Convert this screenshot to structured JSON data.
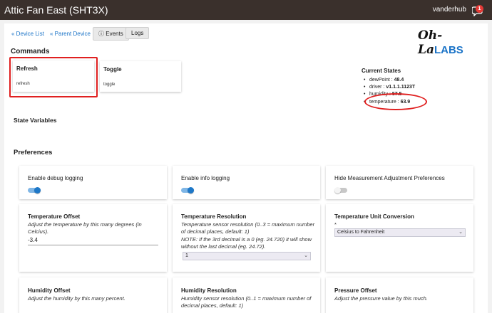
{
  "header": {
    "title": "Attic Fan East (SHT3X)",
    "user": "vanderhub",
    "notification_count": "1"
  },
  "nav": {
    "device_list": "« Device List",
    "parent_device": "« Parent Device",
    "events": "Events",
    "logs": "Logs"
  },
  "logo": {
    "script": "Oh-La",
    "labs": "LABS"
  },
  "commands": {
    "title": "Commands",
    "items": [
      {
        "name": "Refresh",
        "sub": "refresh"
      },
      {
        "name": "Toggle",
        "sub": "toggle"
      }
    ]
  },
  "current_states": {
    "title": "Current States",
    "items": [
      {
        "key": "dewPoint : ",
        "value": "48.4"
      },
      {
        "key": "driver : ",
        "value": "v1.1.1.1123T"
      },
      {
        "key": "humidity : ",
        "value": "57.5"
      },
      {
        "key": "temperature : ",
        "value": "63.9"
      }
    ]
  },
  "state_variables": {
    "title": "State Variables"
  },
  "preferences": {
    "title": "Preferences",
    "debug_logging": {
      "label": "Enable debug logging",
      "on": true
    },
    "info_logging": {
      "label": "Enable info logging",
      "on": true
    },
    "hide_measurement": {
      "label": "Hide Measurement Adjustment Preferences",
      "on": false
    },
    "temperature_offset": {
      "label": "Temperature Offset",
      "desc": "Adjust the temperature by this many degrees (in Celcius).",
      "value": "-3.4"
    },
    "temperature_resolution": {
      "label": "Temperature Resolution",
      "desc": "Temperature sensor resolution (0..3 = maximum number of decimal places, default: 1)",
      "note": "NOTE: If the 3rd decimal is a 0 (eg. 24.720) it will show without the last decimal (eg. 24.72).",
      "value": "1"
    },
    "temperature_unit": {
      "label": "Temperature Unit Conversion",
      "required": "*",
      "value": "Celsius to Fahrenheit"
    },
    "humidity_offset": {
      "label": "Humidity Offset",
      "desc": "Adjust the humidity by this many percent."
    },
    "humidity_resolution": {
      "label": "Humidity Resolution",
      "desc": "Humidity sensor resolution (0..1 = maximum number of decimal places, default: 1)"
    },
    "pressure_offset": {
      "label": "Pressure Offset",
      "desc": "Adjust the pressure value by this much."
    }
  },
  "colors": {
    "topbar": "#3a302c",
    "accent": "#1e78c8",
    "highlight": "#e02020"
  }
}
